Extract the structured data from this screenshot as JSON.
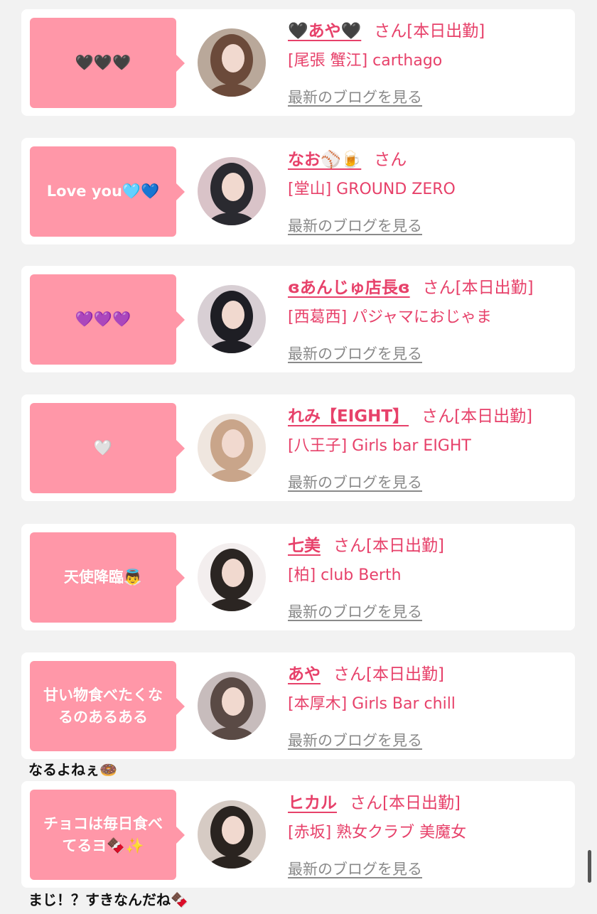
{
  "label_san": "さん",
  "blog_link": "最新のブログを見る",
  "cards": [
    {
      "bubble": "🖤🖤🖤",
      "name": "🖤あや🖤",
      "status": "[本日出勤]",
      "shop": "[尾張 蟹江] carthago",
      "avatar_color": "#6b4a3a",
      "avatar_bg": "#b9a89a"
    },
    {
      "bubble": "Love you🩵💙",
      "name": "なお⚾🍺",
      "status": "",
      "shop": "[堂山] GROUND ZERO",
      "avatar_color": "#2a2a30",
      "avatar_bg": "#d9c3c8"
    },
    {
      "bubble": "💜💜💜",
      "name": "ɞあんじゅ店長ɞ",
      "status": "[本日出勤]",
      "shop": "[西葛西] パジャマにおじゃま",
      "avatar_color": "#1e1e24",
      "avatar_bg": "#d8cfd4"
    },
    {
      "bubble": "🤍",
      "name": "れみ【EIGHT】",
      "status": "[本日出勤]",
      "shop": "[八王子] Girls bar EIGHT",
      "avatar_color": "#c9a58a",
      "avatar_bg": "#efe6df"
    },
    {
      "bubble": "天使降臨👼",
      "name": "七美",
      "status": "[本日出勤]",
      "shop": "[柏] club Berth",
      "avatar_color": "#2b2522",
      "avatar_bg": "#f3eeee"
    },
    {
      "bubble": "甘い物食べたくなるのあるある",
      "name": "あや",
      "status": "[本日出勤]",
      "shop": "[本厚木] Girls Bar chill",
      "avatar_color": "#5a4a45",
      "avatar_bg": "#c7bcbc"
    },
    {
      "bubble": "チョコは毎日食べてるヨ🍫✨",
      "name": "ヒカル",
      "status": "[本日出勤]",
      "shop": "[赤坂] 熟女クラブ 美魔女",
      "avatar_color": "#2a2420",
      "avatar_bg": "#d6cbc4"
    }
  ],
  "replies": [
    {
      "after_card": 5,
      "text": "なるよねぇ🍩"
    },
    {
      "after_card": 6,
      "text": "まじ！？すきなんだね🍫"
    }
  ]
}
